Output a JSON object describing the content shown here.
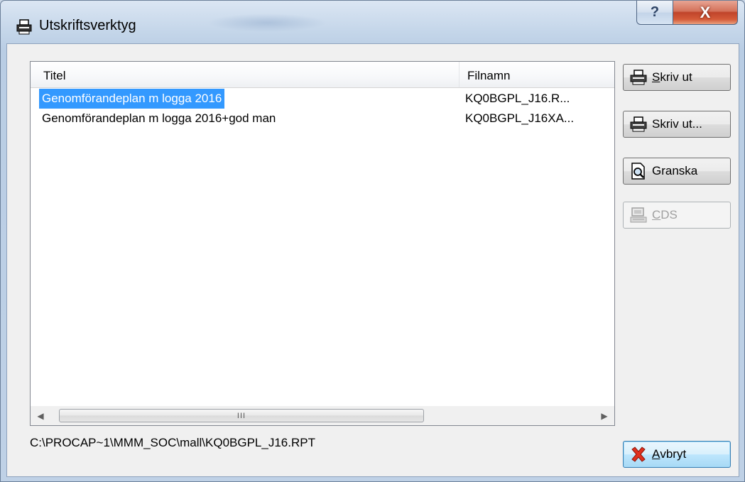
{
  "window": {
    "title": "Utskriftsverktyg",
    "help_label": "?",
    "close_label": "X"
  },
  "list": {
    "columns": [
      "Titel",
      "Filnamn"
    ],
    "rows": [
      {
        "title": "Genomförandeplan m logga 2016",
        "file": "KQ0BGPL_J16.R...",
        "selected": true
      },
      {
        "title": "Genomförandeplan m logga 2016+god man",
        "file": "KQ0BGPL_J16XA...",
        "selected": false
      }
    ],
    "scroll_thumb_label": "III"
  },
  "status_path": "C:\\PROCAP~1\\MMM_SOC\\mall\\KQ0BGPL_J16.RPT",
  "buttons": {
    "print": {
      "mnemonic": "S",
      "rest": "kriv ut",
      "icon": "printer-icon"
    },
    "print_dialog": {
      "label": "Skriv ut...",
      "icon": "printer-icon"
    },
    "preview": {
      "label": "Granska",
      "icon": "document-magnifier-icon"
    },
    "cds": {
      "mnemonic": "C",
      "rest": "DS",
      "icon": "terminal-icon",
      "disabled": true
    },
    "cancel": {
      "mnemonic": "A",
      "rest": "vbryt",
      "icon": "red-x-icon"
    }
  }
}
